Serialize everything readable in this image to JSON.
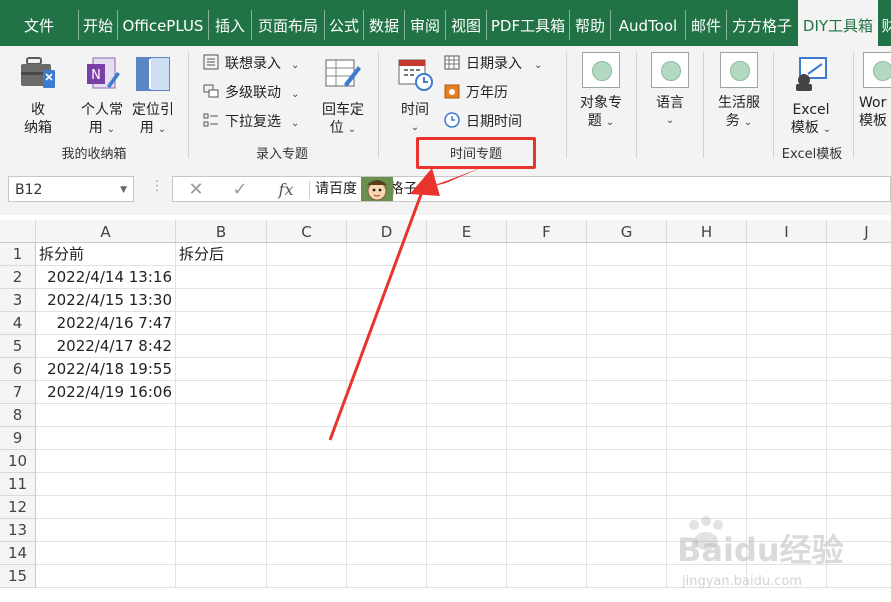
{
  "tabs": [
    "文件",
    "开始",
    "OfficePLUS",
    "插入",
    "页面布局",
    "公式",
    "数据",
    "审阅",
    "视图",
    "PDF工具箱",
    "帮助",
    "AudTool",
    "邮件",
    "方方格子",
    "DIY工具箱",
    "财"
  ],
  "active_tab": "DIY工具箱",
  "ribbon": {
    "group_storage": {
      "label": "我的收纳箱",
      "btn_storage": [
        "收",
        "纳箱"
      ],
      "btn_personal": [
        "个人常",
        "用"
      ],
      "btn_locate": [
        "定位引",
        "用"
      ]
    },
    "group_input": {
      "label": "录入专题",
      "btn_assoc": "联想录入",
      "btn_multilevel": "多级联动",
      "btn_dropdown": "下拉复选",
      "btn_enter": [
        "回车定",
        "位"
      ]
    },
    "group_time": {
      "label": "时间专题",
      "btn_time": "时间",
      "btn_date_input": "日期录入",
      "btn_calendar": "万年历",
      "btn_datetime": "日期时间"
    },
    "group_object": {
      "btn": [
        "对象专",
        "题"
      ]
    },
    "group_language": {
      "btn": "语言"
    },
    "group_life": {
      "btn": [
        "生活服",
        "务"
      ]
    },
    "group_excel": {
      "label": "Excel模板",
      "btn": [
        "Excel",
        "模板"
      ]
    },
    "group_word": {
      "btn": [
        "Wor",
        "模板"
      ]
    }
  },
  "formula_bar": {
    "name_box": "B12",
    "cancel": "✕",
    "confirm": "✓",
    "fx": "fx",
    "content": "请百度  方方格子"
  },
  "sheet": {
    "columns": [
      "A",
      "B",
      "C",
      "D",
      "E",
      "F",
      "G",
      "H",
      "I",
      "J"
    ],
    "rows": [
      "1",
      "2",
      "3",
      "4",
      "5",
      "6",
      "7",
      "8",
      "9",
      "10",
      "11",
      "12",
      "13",
      "14",
      "15"
    ],
    "header_A1": "拆分前",
    "header_B1": "拆分后",
    "values_A": [
      "2022/4/14 13:16",
      "2022/4/15 13:30",
      "2022/4/16 7:47",
      "2022/4/17 8:42",
      "2022/4/18 19:55",
      "2022/4/19 16:06"
    ]
  },
  "watermark": {
    "brand": "Baidu经验",
    "url": "jingyan.baidu.com"
  },
  "colors": {
    "excel_green": "#217346",
    "annotation_red": "#e8342c"
  }
}
